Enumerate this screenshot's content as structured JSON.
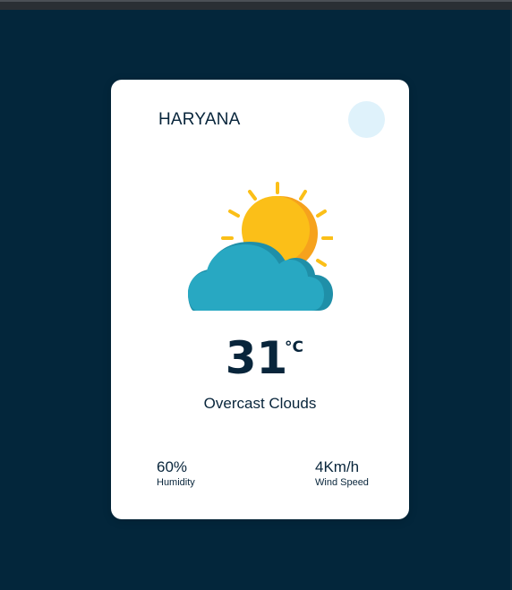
{
  "weather_card": {
    "city": "HARYANA",
    "temperature": "31",
    "temperature_unit": "°C",
    "condition": "Overcast Clouds",
    "humidity": {
      "value": "60%",
      "label": "Humidity"
    },
    "wind_speed": {
      "value": "4Km/h",
      "label": "Wind Speed"
    },
    "icon": "sun-behind-cloud-icon"
  },
  "colors": {
    "background": "#03263b",
    "card": "#ffffff",
    "text": "#08253b",
    "toggle": "#dff2fb",
    "sun": "#fbbf18",
    "cloud": "#28a8c2"
  }
}
